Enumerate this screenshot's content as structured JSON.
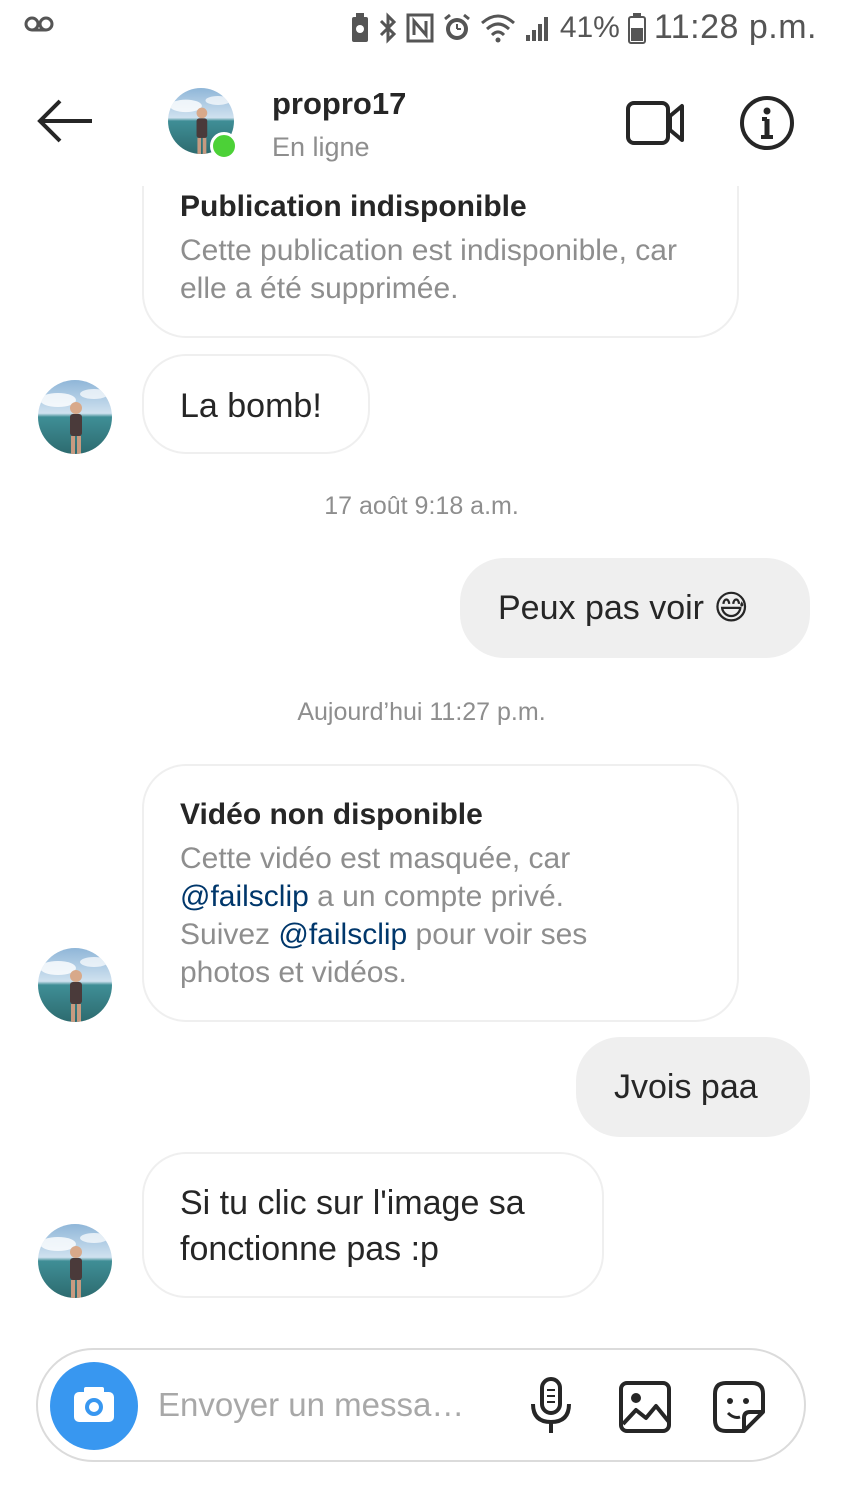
{
  "status_bar": {
    "battery": "41%",
    "time": "11:28 p.m.",
    "icons": [
      "voicemail-icon",
      "battery-saver-icon",
      "bluetooth-icon",
      "nfc-icon",
      "alarm-icon",
      "wifi-icon",
      "signal-icon",
      "battery-icon"
    ]
  },
  "header": {
    "username": "propro17",
    "presence": "En ligne",
    "icons": [
      "back-arrow-icon",
      "video-call-icon",
      "info-icon"
    ],
    "online_color": "#4cd137"
  },
  "messages": {
    "card1": {
      "title": "Publication indisponible",
      "body": "Cette publication est indisponible, car elle a été supprimée."
    },
    "msg1": "La bomb!",
    "ts1": "17 août 9:18 a.m.",
    "msg2": {
      "text": "Peux pas voir",
      "emoji": "😅"
    },
    "ts2": "Aujourd’hui 11:27 p.m.",
    "card2": {
      "title": "Vidéo non disponible",
      "line1": "Cette vidéo est masquée, car",
      "mention": "@failsclip",
      "line2_rest": " a un compte privé.",
      "line3_pre": "Suivez ",
      "line3_rest": " pour voir ses",
      "line4": "photos et vidéos."
    },
    "msg3": "Jvois paa",
    "msg4_line1": "Si tu clic sur l'image sa",
    "msg4_line2": "fonctionne pas :p"
  },
  "composer": {
    "placeholder": "Envoyer un messa…",
    "icons": [
      "camera-icon",
      "microphone-icon",
      "gallery-icon",
      "sticker-icon"
    ],
    "camera_color": "#3897f0"
  },
  "colors": {
    "incoming_border": "#efefef",
    "outgoing_bg": "#efefef",
    "mention": "#00376b",
    "muted_text": "#8e8e8e"
  }
}
